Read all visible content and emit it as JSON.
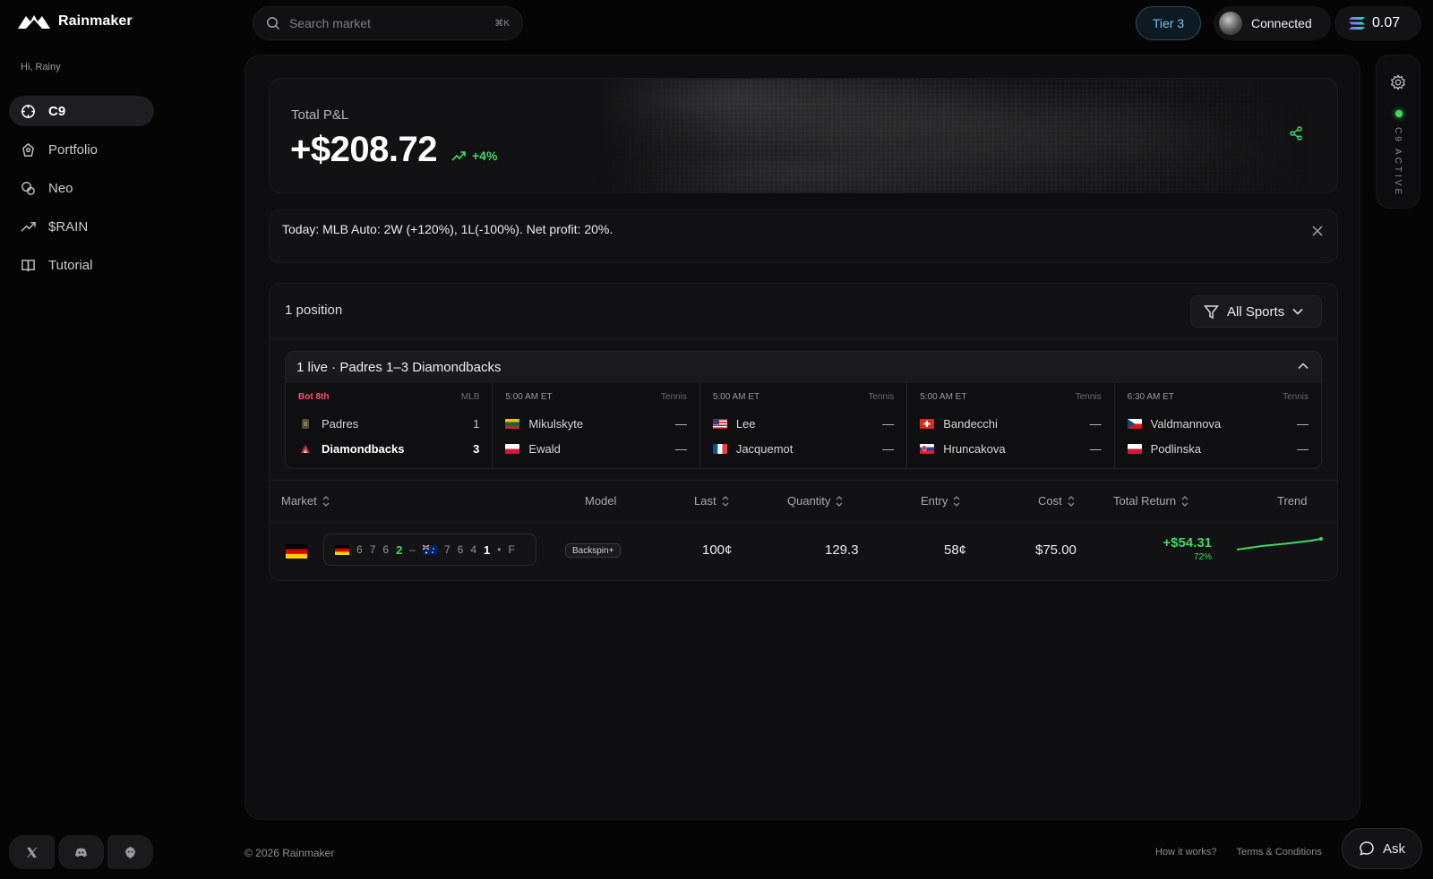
{
  "app": {
    "name": "Rainmaker"
  },
  "sidebar": {
    "greeting": "Hi, Rainy",
    "items": [
      {
        "label": "C9",
        "icon": "crosshair-icon",
        "active": true
      },
      {
        "label": "Portfolio",
        "icon": "portfolio-icon"
      },
      {
        "label": "Neo",
        "icon": "neo-icon"
      },
      {
        "label": "$RAIN",
        "icon": "trending-up-icon"
      },
      {
        "label": "Tutorial",
        "icon": "book-icon"
      }
    ],
    "social": [
      "x-icon",
      "discord-icon",
      "lion-icon"
    ]
  },
  "topbar": {
    "search_placeholder": "Search market",
    "search_shortcut": "⌘K",
    "tier": "Tier 3",
    "connection": "Connected",
    "balance": "0.07"
  },
  "pnl": {
    "label": "Total P&L",
    "value": "+$208.72",
    "change": "+4%"
  },
  "notice": {
    "text": "Today: MLB Auto: 2W (+120%), 1L(-100%). Net profit: 20%."
  },
  "positions": {
    "count_label": "1 position",
    "filter_label": "All Sports",
    "live_header": "1 live · Padres 1–3 Diamondbacks",
    "games": [
      {
        "status": "Bot 8th",
        "league": "MLB",
        "team1": {
          "name": "Padres",
          "score": "1"
        },
        "team2": {
          "name": "Diamondbacks",
          "score": "3"
        }
      },
      {
        "status": "5:00 AM ET",
        "league": "Tennis",
        "team1": {
          "name": "Mikulskyte",
          "score": "—"
        },
        "team2": {
          "name": "Ewald",
          "score": "—"
        }
      },
      {
        "status": "5:00 AM ET",
        "league": "Tennis",
        "team1": {
          "name": "Lee",
          "score": "—"
        },
        "team2": {
          "name": "Jacquemot",
          "score": "—"
        }
      },
      {
        "status": "5:00 AM ET",
        "league": "Tennis",
        "team1": {
          "name": "Bandecchi",
          "score": "—"
        },
        "team2": {
          "name": "Hruncakova",
          "score": "—"
        }
      },
      {
        "status": "6:30 AM ET",
        "league": "Tennis",
        "team1": {
          "name": "Valdmannova",
          "score": "—"
        },
        "team2": {
          "name": "Podlinska",
          "score": "—"
        }
      }
    ],
    "columns": [
      "Market",
      "Model",
      "Last",
      "Quantity",
      "Entry",
      "Cost",
      "Total Return",
      "Trend"
    ],
    "row": {
      "score_a": [
        "6",
        "7",
        "6",
        "2"
      ],
      "score_b": [
        "7",
        "6",
        "4",
        "1"
      ],
      "dash": "–",
      "bullet": "•",
      "tail": "F",
      "model": "Backspin+",
      "last": "100¢",
      "quantity": "129.3",
      "entry": "58¢",
      "cost": "$75.00",
      "total_return": "+$54.31",
      "return_pct": "72%"
    }
  },
  "rail": {
    "status_text": "C9 ACTIVE"
  },
  "footer": {
    "copyright": "© 2026 Rainmaker",
    "how": "How it works?",
    "terms": "Terms & Conditions",
    "ask": "Ask"
  },
  "colors": {
    "accent_green": "#3fd764",
    "tier_blue": "#6fc3ea",
    "live_red": "#ff4d6d",
    "background": "#050506"
  }
}
